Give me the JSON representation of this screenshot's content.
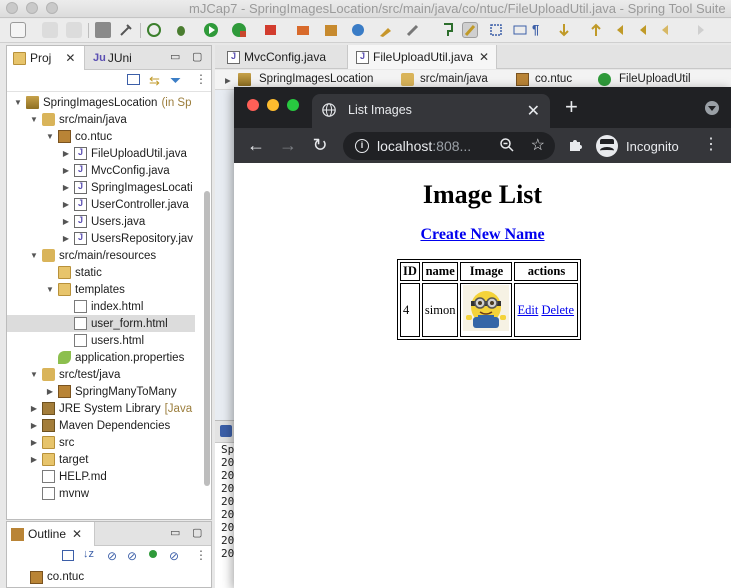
{
  "eclipse": {
    "window_title": "mJCap7 - SpringImagesLocation/src/main/java/co/ntuc/FileUploadUtil.java - Spring Tool Suite",
    "left_tabs": {
      "project": "Proj",
      "junit": "JUni"
    },
    "tree": [
      {
        "label": "SpringImagesLocation",
        "extra": "(in Sp",
        "icon": "project",
        "depth": 0,
        "open": true
      },
      {
        "label": "src/main/java",
        "icon": "srcfolder",
        "depth": 1,
        "open": true
      },
      {
        "label": "co.ntuc",
        "icon": "pkg",
        "depth": 2,
        "open": true
      },
      {
        "label": "FileUploadUtil.java",
        "icon": "java",
        "depth": 3,
        "open": false
      },
      {
        "label": "MvcConfig.java",
        "icon": "java",
        "depth": 3,
        "open": false
      },
      {
        "label": "SpringImagesLocati",
        "icon": "java",
        "depth": 3,
        "open": false
      },
      {
        "label": "UserController.java",
        "icon": "java",
        "depth": 3,
        "open": false
      },
      {
        "label": "Users.java",
        "icon": "java",
        "depth": 3,
        "open": false
      },
      {
        "label": "UsersRepository.jav",
        "icon": "java",
        "depth": 3,
        "open": false
      },
      {
        "label": "src/main/resources",
        "icon": "srcfolder",
        "depth": 1,
        "open": true
      },
      {
        "label": "static",
        "icon": "folder",
        "depth": 2,
        "open": null
      },
      {
        "label": "templates",
        "icon": "folder",
        "depth": 2,
        "open": true
      },
      {
        "label": "index.html",
        "icon": "file",
        "depth": 3,
        "open": null
      },
      {
        "label": "user_form.html",
        "icon": "file",
        "depth": 3,
        "open": null,
        "selected": true
      },
      {
        "label": "users.html",
        "icon": "file",
        "depth": 3,
        "open": null
      },
      {
        "label": "application.properties",
        "icon": "props",
        "depth": 2,
        "open": null
      },
      {
        "label": "src/test/java",
        "icon": "srcfolder",
        "depth": 1,
        "open": true
      },
      {
        "label": "SpringManyToMany",
        "icon": "pkg",
        "depth": 2,
        "open": false
      },
      {
        "label": "JRE System Library",
        "extra": "[Java",
        "icon": "lib",
        "depth": 1,
        "open": false
      },
      {
        "label": "Maven Dependencies",
        "icon": "lib",
        "depth": 1,
        "open": false
      },
      {
        "label": "src",
        "icon": "folder",
        "depth": 1,
        "open": false
      },
      {
        "label": "target",
        "icon": "folder",
        "depth": 1,
        "open": false
      },
      {
        "label": "HELP.md",
        "icon": "md",
        "depth": 1,
        "open": null
      },
      {
        "label": "mvnw",
        "icon": "file",
        "depth": 1,
        "open": null
      }
    ],
    "outline": {
      "tab_label": "Outline",
      "item": "co.ntuc"
    },
    "editor_tabs": [
      {
        "label": "MvcConfig.java",
        "active": false
      },
      {
        "label": "FileUploadUtil.java",
        "active": true
      }
    ],
    "breadcrumb": [
      "SpringImagesLocation",
      "src/main/java",
      "co.ntuc",
      "FileUploadUtil"
    ],
    "console": {
      "label": "Spr",
      "lines": [
        "20",
        "20",
        "20",
        "20",
        "20",
        "20",
        "20",
        "20"
      ]
    }
  },
  "browser": {
    "tab_title": "List Images",
    "url_host": "localhost",
    "url_rest": ":808...",
    "profile_label": "Incognito",
    "page": {
      "heading": "Image List",
      "create_link": "Create New Name",
      "table": {
        "headers": [
          "ID",
          "name",
          "Image",
          "actions"
        ],
        "rows": [
          {
            "id": "4",
            "name": "simon",
            "image": "minion-image",
            "edit": "Edit",
            "delete": "Delete"
          }
        ]
      }
    }
  },
  "colors": {
    "chrome_dark": "#202124",
    "chrome_toolbar": "#35363a",
    "link": "#0000ee",
    "selection": "#dcdcdc"
  }
}
